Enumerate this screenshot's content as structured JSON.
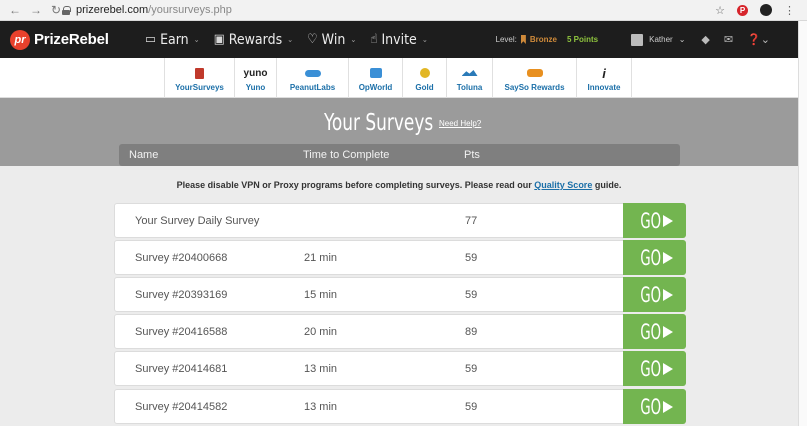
{
  "browser": {
    "url_host": "prizerebel.com",
    "url_path": "/yoursurveys.php"
  },
  "site": {
    "logo_text": "PrizeRebel",
    "logo_mark": "pr",
    "menu": [
      {
        "label": "Earn",
        "icon": "monitor-icon"
      },
      {
        "label": "Rewards",
        "icon": "gift-icon"
      },
      {
        "label": "Win",
        "icon": "heart-icon"
      },
      {
        "label": "Invite",
        "icon": "thumbs-up-icon"
      }
    ],
    "level_label": "Level:",
    "level_value": "Bronze",
    "points": "5 Points",
    "username": "Kather"
  },
  "providers": [
    {
      "label": "YourSurveys",
      "icon": "yoursurveys-icon"
    },
    {
      "label": "Yuno",
      "icon": "yuno-icon",
      "brand": "yuno"
    },
    {
      "label": "PeanutLabs",
      "icon": "peanutlabs-icon"
    },
    {
      "label": "OpWorld",
      "icon": "opworld-icon"
    },
    {
      "label": "Gold",
      "icon": "gold-icon"
    },
    {
      "label": "Toluna",
      "icon": "toluna-icon"
    },
    {
      "label": "SaySo Rewards",
      "icon": "sayso-icon"
    },
    {
      "label": "Innovate",
      "icon": "innovate-icon",
      "brand": "i"
    }
  ],
  "page": {
    "title": "Your Surveys",
    "need_help": "Need Help?",
    "columns": {
      "name": "Name",
      "time": "Time to Complete",
      "pts": "Pts"
    },
    "notice_prefix": "Please disable VPN or Proxy programs before completing surveys. Please read our ",
    "notice_link": "Quality Score",
    "notice_suffix": " guide."
  },
  "surveys": [
    {
      "name": "Your Survey Daily Survey",
      "time": "",
      "pts": "77",
      "go": "GO"
    },
    {
      "name": "Survey #20400668",
      "time": "21 min",
      "pts": "59",
      "go": "GO"
    },
    {
      "name": "Survey #20393169",
      "time": "15 min",
      "pts": "59",
      "go": "GO"
    },
    {
      "name": "Survey #20416588",
      "time": "20 min",
      "pts": "89",
      "go": "GO"
    },
    {
      "name": "Survey #20414681",
      "time": "13 min",
      "pts": "59",
      "go": "GO"
    },
    {
      "name": "Survey #20414582",
      "time": "13 min",
      "pts": "59",
      "go": "GO"
    }
  ],
  "colors": {
    "go_green": "#73b550",
    "nav_dark": "#1d1d1d",
    "link_blue": "#1b6fa8",
    "band_gray": "#9b9b9b"
  }
}
